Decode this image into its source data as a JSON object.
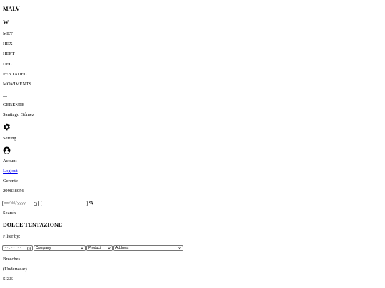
{
  "brand": {
    "title": "MALV"
  },
  "logo": {
    "letter": "W"
  },
  "nav": {
    "items": [
      {
        "label": "MET"
      },
      {
        "label": "HEX"
      },
      {
        "label": "HEPT"
      },
      {
        "label": "DEC"
      },
      {
        "label": "PENTADEC"
      },
      {
        "label": "MOVIMENTS"
      }
    ]
  },
  "menu_icon": "hamburger-menu-icon",
  "user": {
    "role_heading": "GERENTE",
    "name": "Santiago Gómez"
  },
  "settings": {
    "icon": "gear-icon",
    "label": "Setting"
  },
  "account": {
    "icon": "user-circle-icon",
    "label": "Acount"
  },
  "logout": {
    "label": "Log out"
  },
  "profile": {
    "role": "Gerente",
    "phone": "299838056"
  },
  "search_bar": {
    "date_placeholder": "mm/dd/yyyy",
    "text_value": "",
    "icon": "search-icon",
    "label": "Search"
  },
  "store": {
    "title": "DOLCE TENTAZIONE"
  },
  "filters": {
    "label": "Filter by:",
    "time_placeholder": "--:-- --",
    "company": "Company",
    "product": "Product",
    "address": "Address"
  },
  "product": {
    "name": "Breeches",
    "category": "(Underwear)",
    "size_label": "SIZE"
  }
}
